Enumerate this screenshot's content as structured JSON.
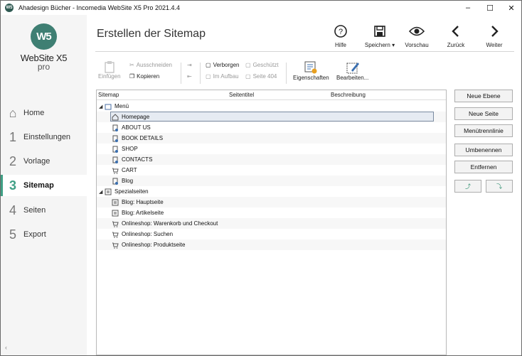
{
  "window": {
    "title": "Ahadesign Bücher - Incomedia WebSite X5 Pro 2021.4.4",
    "app_icon": "W5",
    "minimize": "–",
    "maximize": "☐",
    "close": "✕"
  },
  "logo": {
    "badge": "W5",
    "name": "WebSite X5",
    "edition": "pro"
  },
  "nav": {
    "items": [
      {
        "num": "⌂",
        "label": "Home"
      },
      {
        "num": "1",
        "label": "Einstellungen"
      },
      {
        "num": "2",
        "label": "Vorlage"
      },
      {
        "num": "3",
        "label": "Sitemap"
      },
      {
        "num": "4",
        "label": "Seiten"
      },
      {
        "num": "5",
        "label": "Export"
      }
    ],
    "active_index": 3,
    "collapse": "‹"
  },
  "header": {
    "page_title": "Erstellen der Sitemap",
    "buttons": {
      "help": "Hilfe",
      "save": "Speichern ▾",
      "preview": "Vorschau",
      "back": "Zurück",
      "next": "Weiter"
    }
  },
  "toolbar": {
    "paste": "Einfügen",
    "cut": "Ausschneiden",
    "copy": "Kopieren",
    "hidden": "Verborgen",
    "under_construction": "Im Aufbau",
    "protected": "Geschützt",
    "page404": "Seite 404",
    "properties": "Eigenschaften",
    "edit": "Bearbeiten..."
  },
  "tree": {
    "columns": [
      "Sitemap",
      "Seitentitel",
      "Beschreibung"
    ],
    "menu_root": "Menü",
    "menu_items": [
      "Homepage",
      "ABOUT US",
      "BOOK DETAILS",
      "SHOP",
      "CONTACTS",
      "CART",
      "Blog"
    ],
    "special_root": "Spezialseiten",
    "special_items": [
      "Blog: Hauptseite",
      "Blog: Artikelseite",
      "Onlineshop: Warenkorb und Checkout",
      "Onlineshop: Suchen",
      "Onlineshop: Produktseite"
    ],
    "expand_glyph": "◢",
    "selected": "Homepage"
  },
  "actions": {
    "new_level": "Neue Ebene",
    "new_page": "Neue Seite",
    "menu_separator": "Menütrennlinie",
    "rename": "Umbenennen",
    "remove": "Entfernen",
    "move_up": "⤴",
    "move_down": "⤵"
  },
  "colors": {
    "accent": "#3f9f85",
    "logo": "#3f7f73",
    "selection": "#e6ebf2"
  }
}
